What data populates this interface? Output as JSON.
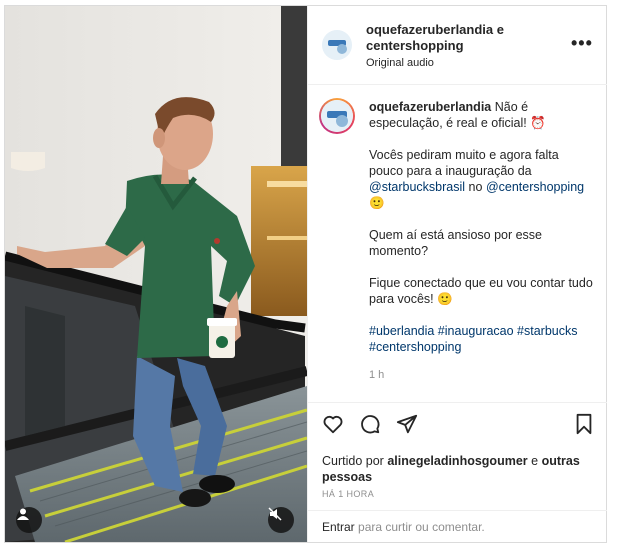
{
  "post": {
    "header": {
      "account_name": "oquefazeruberlandia e centershopping",
      "audio": "Original audio",
      "more_label": "•••"
    },
    "caption": {
      "username": "oquefazeruberlandia",
      "line1": "Não é especulação, é real e oficial! ⏰",
      "p2_start": "Vocês pediram muito e agora falta pouco para a inauguração da",
      "mention1": "@starbucksbrasil",
      "p2_mid": "no",
      "mention2": "@centershopping",
      "p2_end": "🙂",
      "p3": "Quem aí está ansioso por esse momento?",
      "p4": "Fique conectado que eu vou contar tudo para vocês! 🙂",
      "hashtags": "#uberlandia #inauguracao #starbucks #centershopping",
      "time": "1 h"
    },
    "likes": {
      "prefix": "Curtido por",
      "user": "alinegeladinhosgoumer",
      "mid": "e",
      "others": "outras pessoas"
    },
    "posted_ago": "HÁ 1 HORA",
    "comment": {
      "enter_label": "Entrar",
      "placeholder": "para curtir ou comentar."
    },
    "icons": [
      "heart-icon",
      "comment-icon",
      "share-icon",
      "save-icon",
      "user-tag-icon",
      "mute-icon",
      "more-icon"
    ],
    "colors": {
      "link": "#00376b",
      "muted": "#8e8e8e",
      "border": "#dbdbdb",
      "shirt": "#2d6a48",
      "jeans": "#5578a6"
    }
  }
}
